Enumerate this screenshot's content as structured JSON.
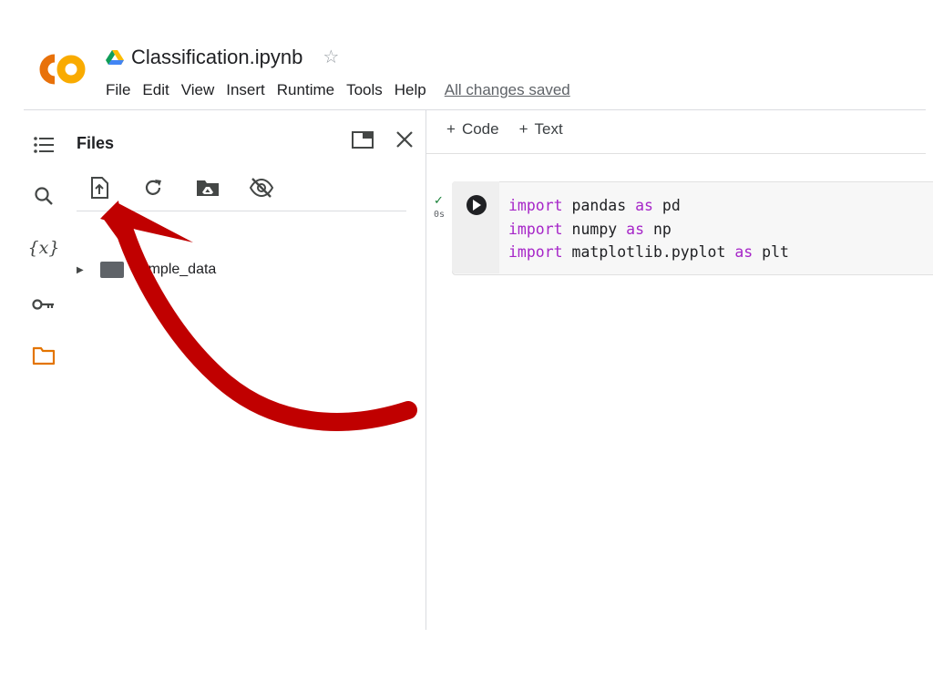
{
  "app": {
    "logo_icon": "colab-logo",
    "brand_color": "#f9ab00"
  },
  "header": {
    "drive_icon": "google-drive-icon",
    "title": "Classification.ipynb",
    "star_icon": "star-icon",
    "menu": [
      {
        "label": "File"
      },
      {
        "label": "Edit"
      },
      {
        "label": "View"
      },
      {
        "label": "Insert"
      },
      {
        "label": "Runtime"
      },
      {
        "label": "Tools"
      },
      {
        "label": "Help"
      }
    ],
    "save_status": "All changes saved"
  },
  "rail": {
    "items": [
      {
        "icon": "table-of-contents-icon"
      },
      {
        "icon": "search-icon"
      },
      {
        "icon": "variables-icon",
        "glyph": "{x}"
      },
      {
        "icon": "secrets-key-icon"
      },
      {
        "icon": "files-folder-icon",
        "active": true,
        "color": "#e37400"
      }
    ]
  },
  "files_panel": {
    "title": "Files",
    "toolbar": [
      {
        "icon": "upload-file-icon"
      },
      {
        "icon": "refresh-icon"
      },
      {
        "icon": "mount-drive-icon"
      },
      {
        "icon": "hide-files-icon"
      }
    ],
    "tree": [
      {
        "label": "sample_data",
        "icon": "folder-icon",
        "expanded": false
      }
    ]
  },
  "notebook": {
    "toolbar": {
      "add_code": "Code",
      "add_text": "Text",
      "plus": "+"
    },
    "cells": [
      {
        "status": "✓",
        "exec_time": "0s",
        "lines": [
          {
            "kw1": "import",
            "mod": " pandas ",
            "kw2": "as",
            "alias": " pd"
          },
          {
            "kw1": "import",
            "mod": " numpy ",
            "kw2": "as",
            "alias": " np"
          },
          {
            "kw1": "import",
            "mod": " matplotlib.pyplot ",
            "kw2": "as",
            "alias": " plt"
          }
        ]
      }
    ]
  },
  "annotation": {
    "arrow_color": "#c00000"
  }
}
